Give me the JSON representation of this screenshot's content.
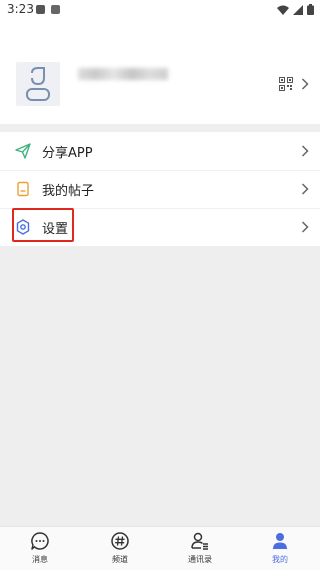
{
  "status_bar": {
    "time": "3:23"
  },
  "profile": {},
  "menu": {
    "items": [
      {
        "label": "分享APP",
        "icon": "send-icon",
        "color": "#3fb37f"
      },
      {
        "label": "我的帖子",
        "icon": "document-icon",
        "color": "#f0a030"
      },
      {
        "label": "设置",
        "icon": "gear-icon",
        "color": "#4a6ee0"
      }
    ]
  },
  "bottom_nav": {
    "active_color": "#4a6ee0",
    "items": [
      {
        "label": "消息",
        "icon": "chat-icon"
      },
      {
        "label": "频道",
        "icon": "hash-icon"
      },
      {
        "label": "通讯录",
        "icon": "contacts-icon"
      },
      {
        "label": "我的",
        "icon": "person-icon",
        "active": true
      }
    ]
  }
}
